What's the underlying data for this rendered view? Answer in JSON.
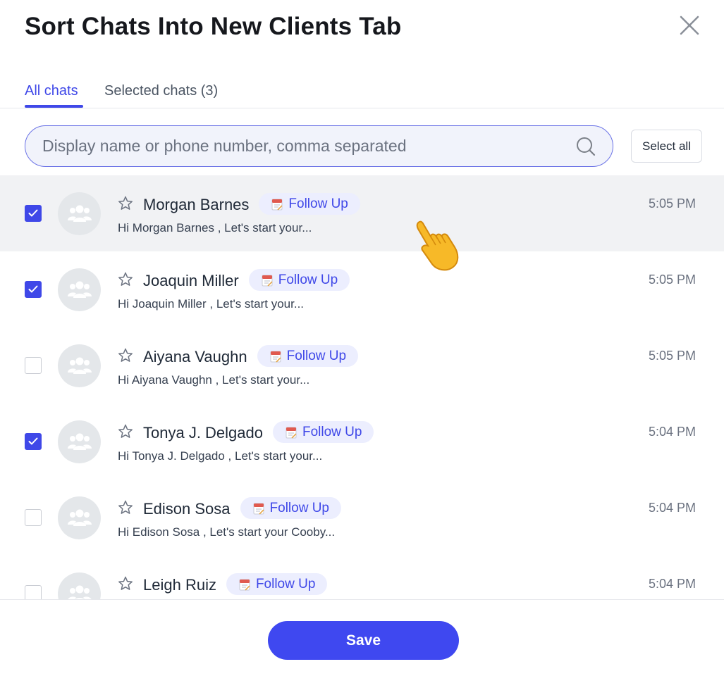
{
  "dialog": {
    "title": "Sort Chats Into New Clients Tab",
    "close_icon": "close-icon"
  },
  "tabs": [
    {
      "label": "All chats",
      "active": true
    },
    {
      "label": "Selected chats (3)",
      "active": false
    }
  ],
  "search": {
    "value": "",
    "placeholder": "Display name or phone number, comma separated",
    "icon": "search-icon"
  },
  "select_all_label": "Select all",
  "chats": [
    {
      "name": "Morgan Barnes",
      "tag": "Follow Up",
      "preview": "Hi Morgan Barnes , Let's start your...",
      "time": "5:05 PM",
      "checked": true,
      "hovered": true
    },
    {
      "name": "Joaquin Miller",
      "tag": "Follow Up",
      "preview": "Hi Joaquin Miller , Let's start your...",
      "time": "5:05 PM",
      "checked": true,
      "hovered": false
    },
    {
      "name": "Aiyana Vaughn",
      "tag": "Follow Up",
      "preview": "Hi Aiyana Vaughn , Let's start your...",
      "time": "5:05 PM",
      "checked": false,
      "hovered": false
    },
    {
      "name": "Tonya J. Delgado",
      "tag": "Follow Up",
      "preview": "Hi Tonya J. Delgado , Let's start your...",
      "time": "5:04 PM",
      "checked": true,
      "hovered": false
    },
    {
      "name": "Edison Sosa",
      "tag": "Follow Up",
      "preview": "Hi Edison Sosa , Let's start your Cooby...",
      "time": "5:04 PM",
      "checked": false,
      "hovered": false
    },
    {
      "name": "Leigh Ruiz",
      "tag": "Follow Up",
      "preview": "",
      "time": "5:04 PM",
      "checked": false,
      "hovered": false
    }
  ],
  "footer": {
    "save_label": "Save"
  },
  "colors": {
    "accent": "#3f48e8",
    "tag_bg": "#eceefe",
    "hover_row": "#f1f2f4"
  }
}
